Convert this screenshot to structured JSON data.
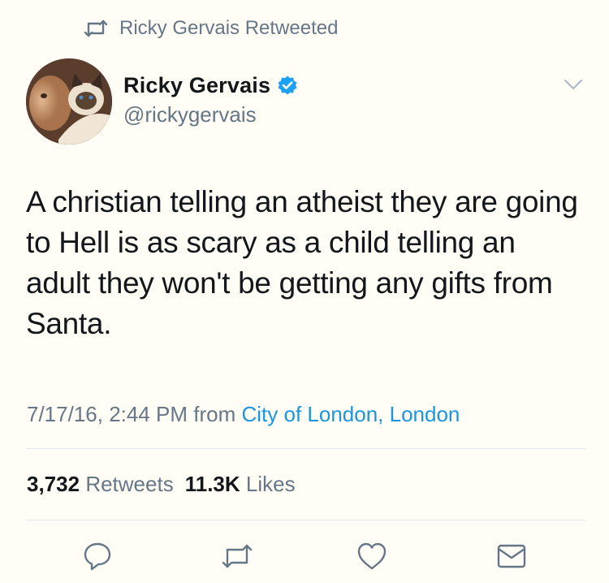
{
  "retweet_context": {
    "icon": "retweet-icon",
    "text": "Ricky Gervais Retweeted"
  },
  "author": {
    "avatar_icon": "avatar-photo",
    "name": "Ricky Gervais",
    "verified_icon": "verified-badge-icon",
    "handle": "@rickygervais"
  },
  "tweet": {
    "text": "A christian telling an atheist they are going to Hell is as scary as a child telling an adult they won't be getting any gifts from Santa.",
    "timestamp": "7/17/16, 2:44 PM",
    "from_label": "from",
    "source": "City of London, London"
  },
  "stats": {
    "retweets_count": "3,732",
    "retweets_label": "Retweets",
    "likes_count": "11.3K",
    "likes_label": "Likes"
  },
  "actions": [
    "reply-icon",
    "retweet-icon",
    "like-icon",
    "share-mail-icon"
  ],
  "colors": {
    "text_primary": "#14171a",
    "text_secondary": "#657786",
    "link": "#1b95e0",
    "verified": "#1da1f2",
    "divider": "#e1e8ed",
    "background": "#fffdf6"
  }
}
